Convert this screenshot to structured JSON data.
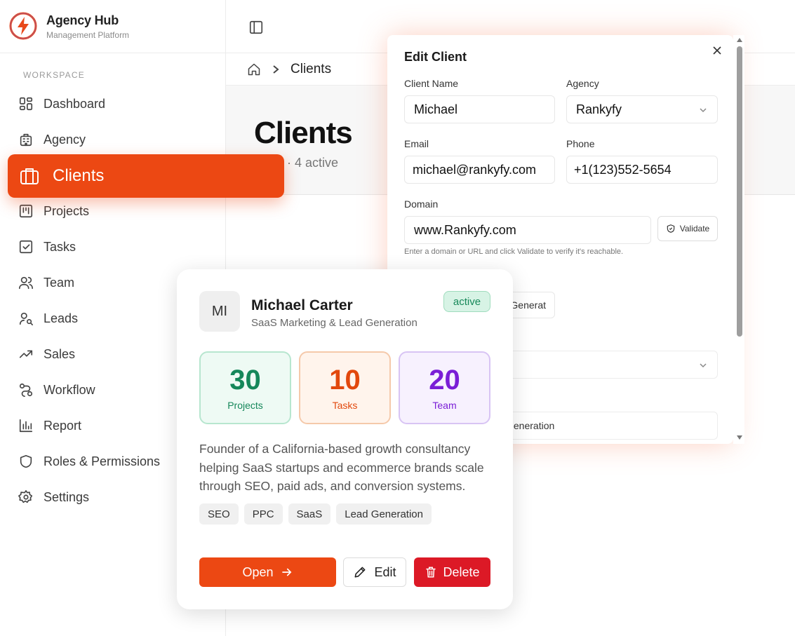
{
  "brand": {
    "title": "Agency Hub",
    "subtitle": "Management Platform"
  },
  "sidebar": {
    "section_label": "WORKSPACE",
    "items": [
      {
        "label": "Dashboard",
        "icon": "dashboard-icon"
      },
      {
        "label": "Agency",
        "icon": "building-icon"
      },
      {
        "label": "Clients",
        "icon": "briefcase-icon",
        "active": true
      },
      {
        "label": "Projects",
        "icon": "kanban-icon"
      },
      {
        "label": "Tasks",
        "icon": "checkbox-icon"
      },
      {
        "label": "Team",
        "icon": "users-icon"
      },
      {
        "label": "Leads",
        "icon": "user-search-icon"
      },
      {
        "label": "Sales",
        "icon": "trending-up-icon"
      },
      {
        "label": "Workflow",
        "icon": "workflow-icon"
      },
      {
        "label": "Report",
        "icon": "bar-chart-icon"
      },
      {
        "label": "Roles & Permissions",
        "icon": "shield-icon"
      },
      {
        "label": "Settings",
        "icon": "gear-icon"
      }
    ]
  },
  "breadcrumb": {
    "current": "Clients"
  },
  "page": {
    "title": "Clients",
    "subtitle": "nts · 4 active"
  },
  "modal": {
    "title": "Edit Client",
    "client_name_label": "Client Name",
    "client_name_value": "Michael",
    "agency_label": "Agency",
    "agency_value": "Rankyfy",
    "email_label": "Email",
    "email_value": "michael@rankyfy.com",
    "phone_label": "Phone",
    "phone_value": "+1(123)552-5654",
    "domain_label": "Domain",
    "domain_value": "www.Rankyfy.com",
    "validate_label": "Validate",
    "domain_hint": "Enter a domain or URL and click Validate to verify it's reachable.",
    "generate_partial": "Generat",
    "industry_partial": "Generation"
  },
  "card": {
    "initials": "MI",
    "name": "Michael Carter",
    "role": "SaaS Marketing & Lead Generation",
    "status": "active",
    "stats": [
      {
        "value": "30",
        "label": "Projects"
      },
      {
        "value": "10",
        "label": "Tasks"
      },
      {
        "value": "20",
        "label": "Team"
      }
    ],
    "bio": "Founder of a California-based growth consultancy helping SaaS startups and ecommerce brands scale through SEO, paid ads, and conversion systems.",
    "tags": [
      "SEO",
      "PPC",
      "SaaS",
      "Lead Generation"
    ],
    "open_label": "Open",
    "edit_label": "Edit",
    "delete_label": "Delete"
  },
  "colors": {
    "accent": "#ec4813",
    "danger": "#dc1926",
    "success": "#15875a",
    "purple": "#7a1ed6"
  }
}
